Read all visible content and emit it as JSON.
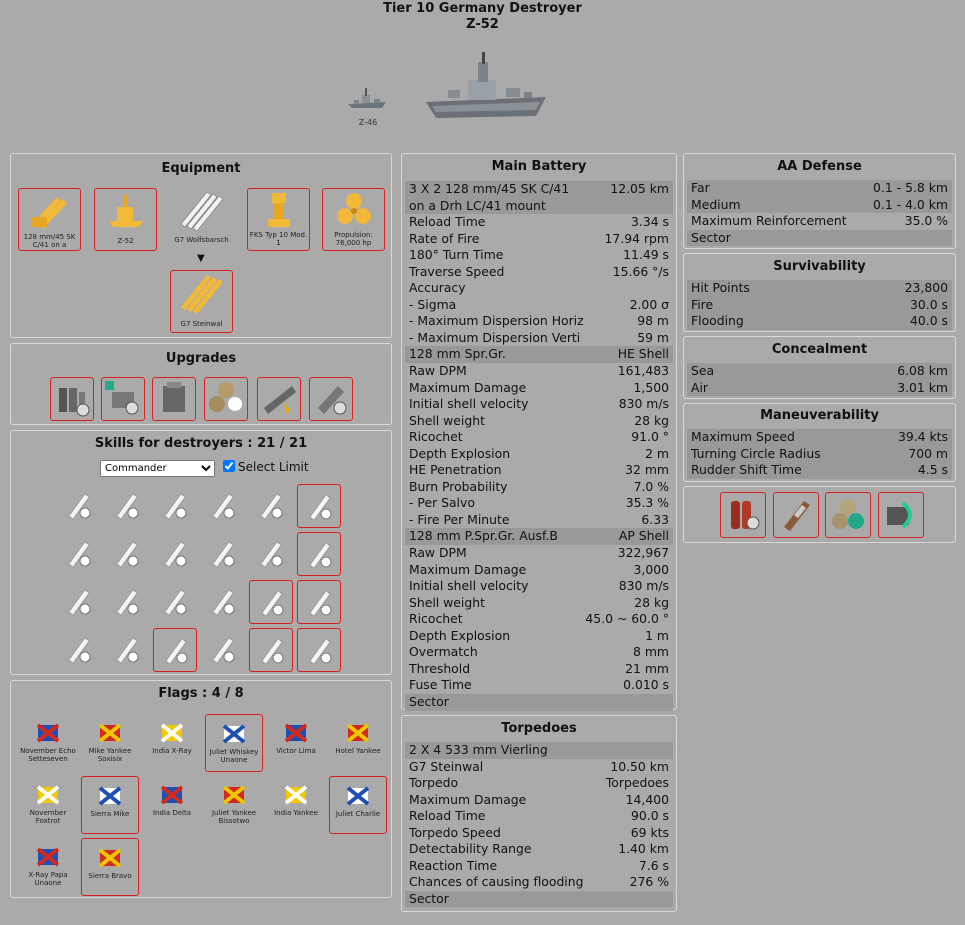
{
  "header": {
    "line1": "Tier 10 Germany Destroyer",
    "line2": "Z-52"
  },
  "ships": {
    "prev_label": "Z-46"
  },
  "equipment": {
    "title": "Equipment",
    "items": [
      {
        "label": "128 mm/45 SK C/41 on a",
        "icon": "gun-icon",
        "highlighted": true
      },
      {
        "label": "Z-52",
        "icon": "hull-icon",
        "highlighted": true
      },
      {
        "label": "G7 Wolfsbarsch",
        "icon": "torpedo-icon",
        "highlighted": false
      },
      {
        "label": "FKS Typ 10 Mod. 1",
        "icon": "fire-control-icon",
        "highlighted": true
      },
      {
        "label": "Propulsion: 76,000 hp",
        "icon": "propeller-icon",
        "highlighted": true
      }
    ],
    "arrow": "▼",
    "upgrade_item": {
      "label": "G7 Steinwal",
      "icon": "torpedo-icon"
    }
  },
  "upgrades": {
    "title": "Upgrades",
    "count": 6
  },
  "skills": {
    "title": "Skills for destroyers : 21 / 21",
    "commander_select": "Commander",
    "select_limit_label": "Select Limit",
    "select_limit_checked": true
  },
  "flags": {
    "title": "Flags : 4 / 8",
    "items": [
      {
        "label": "November Echo Setteseven",
        "selected": false
      },
      {
        "label": "Mike Yankee Soxisix",
        "selected": false
      },
      {
        "label": "India X-Ray",
        "selected": false
      },
      {
        "label": "Juliet Whiskey Unaone",
        "selected": true
      },
      {
        "label": "Victor Lima",
        "selected": false
      },
      {
        "label": "Hotel Yankee",
        "selected": false
      },
      {
        "label": "November Foxtrot",
        "selected": false
      },
      {
        "label": "Sierra Mike",
        "selected": true
      },
      {
        "label": "India Delta",
        "selected": false
      },
      {
        "label": "Juliet Yankee Bissotwo",
        "selected": false
      },
      {
        "label": "India Yankee",
        "selected": false
      },
      {
        "label": "Juliet Charlie",
        "selected": true
      },
      {
        "label": "X-Ray Papa Unaone",
        "selected": false
      },
      {
        "label": "Sierra Bravo",
        "selected": true
      }
    ]
  },
  "main_battery": {
    "title": "Main Battery",
    "rows": [
      {
        "l": "3 X 2 128 mm/45 SK C/41",
        "v": "12.05 km",
        "shade": true
      },
      {
        "l": "on a Drh LC/41 mount",
        "v": "",
        "shade": true
      },
      {
        "l": "Reload Time",
        "v": "3.34 s"
      },
      {
        "l": "Rate of Fire",
        "v": "17.94 rpm"
      },
      {
        "l": "180° Turn Time",
        "v": "11.49 s"
      },
      {
        "l": "Traverse Speed",
        "v": "15.66 °/s"
      },
      {
        "l": "Accuracy",
        "v": ""
      },
      {
        "l": "- Sigma",
        "v": "2.00 σ"
      },
      {
        "l": "- Maximum Dispersion Horiz",
        "v": "98 m"
      },
      {
        "l": "- Maximum Dispersion Verti",
        "v": "59 m"
      },
      {
        "l": "128 mm Spr.Gr.",
        "v": "HE Shell",
        "shade": true
      },
      {
        "l": "Raw DPM",
        "v": "161,483"
      },
      {
        "l": "Maximum Damage",
        "v": "1,500"
      },
      {
        "l": "Initial shell velocity",
        "v": "830 m/s"
      },
      {
        "l": "Shell weight",
        "v": "28 kg"
      },
      {
        "l": "Ricochet",
        "v": "91.0 °"
      },
      {
        "l": "Depth Explosion",
        "v": "2 m"
      },
      {
        "l": "HE Penetration",
        "v": "32 mm"
      },
      {
        "l": "Burn Probability",
        "v": "7.0 %"
      },
      {
        "l": "- Per Salvo",
        "v": "35.3 %"
      },
      {
        "l": "- Fire Per Minute",
        "v": "6.33"
      },
      {
        "l": "128 mm P.Spr.Gr. Ausf.B",
        "v": "AP Shell",
        "shade": true
      },
      {
        "l": "Raw DPM",
        "v": "322,967"
      },
      {
        "l": "Maximum Damage",
        "v": "3,000"
      },
      {
        "l": "Initial shell velocity",
        "v": "830 m/s"
      },
      {
        "l": "Shell weight",
        "v": "28 kg"
      },
      {
        "l": "Ricochet",
        "v": "45.0 ~ 60.0 °"
      },
      {
        "l": "Depth Explosion",
        "v": "1 m"
      },
      {
        "l": "Overmatch",
        "v": "8 mm"
      },
      {
        "l": "Threshold",
        "v": "21 mm"
      },
      {
        "l": "Fuse Time",
        "v": "0.010 s"
      },
      {
        "l": "Sector",
        "v": "",
        "shade": true
      }
    ]
  },
  "torpedoes": {
    "title": "Torpedoes",
    "rows": [
      {
        "l": "2 X 4 533 mm Vierling",
        "v": "",
        "shade": true
      },
      {
        "l": "G7 Steinwal",
        "v": "10.50 km"
      },
      {
        "l": "Torpedo",
        "v": "Torpedoes"
      },
      {
        "l": "Maximum Damage",
        "v": "14,400"
      },
      {
        "l": "Reload Time",
        "v": "90.0 s"
      },
      {
        "l": "Torpedo Speed",
        "v": "69 kts"
      },
      {
        "l": "Detectability Range",
        "v": "1.40 km"
      },
      {
        "l": "Reaction Time",
        "v": "7.6 s"
      },
      {
        "l": "Chances of causing flooding",
        "v": "276 %"
      },
      {
        "l": "Sector",
        "v": "",
        "shade": true
      }
    ]
  },
  "aa_defense": {
    "title": "AA Defense",
    "rows": [
      {
        "l": "Far",
        "v": "0.1 - 5.8 km",
        "shade": true
      },
      {
        "l": "Medium",
        "v": "0.1 - 4.0 km",
        "shade": true
      },
      {
        "l": "Maximum Reinforcement",
        "v": "35.0 %"
      },
      {
        "l": "Sector",
        "v": "",
        "shade": true
      }
    ]
  },
  "survivability": {
    "title": "Survivability",
    "rows": [
      {
        "l": "Hit Points",
        "v": "23,800",
        "shade": true
      },
      {
        "l": "Fire",
        "v": "30.0 s",
        "shade": true
      },
      {
        "l": "Flooding",
        "v": "40.0 s",
        "shade": true
      }
    ]
  },
  "concealment": {
    "title": "Concealment",
    "rows": [
      {
        "l": "Sea",
        "v": "6.08 km",
        "shade": true
      },
      {
        "l": "Air",
        "v": "3.01 km",
        "shade": true
      }
    ]
  },
  "maneuverability": {
    "title": "Maneuverability",
    "rows": [
      {
        "l": "Maximum Speed",
        "v": "39.4 kts",
        "shade": true
      },
      {
        "l": "Turning Circle Radius",
        "v": "700 m",
        "shade": true
      },
      {
        "l": "Rudder Shift Time",
        "v": "4.5 s",
        "shade": true
      }
    ]
  },
  "consumables": {
    "items": [
      "damage-control-icon",
      "smoke-generator-icon",
      "engine-boost-icon",
      "hydroacoustic-search-icon"
    ]
  }
}
